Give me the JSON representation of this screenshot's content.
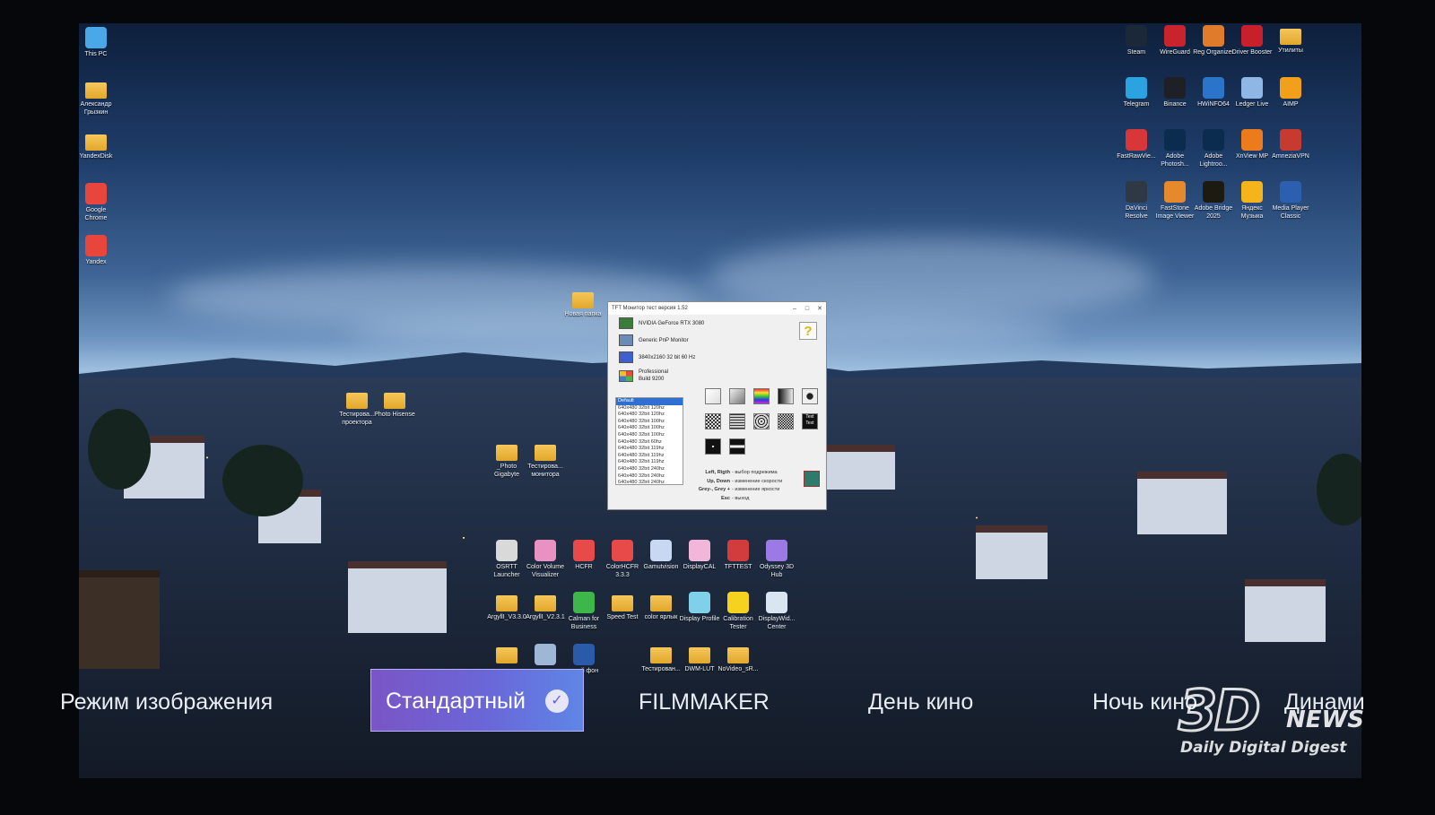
{
  "desktop_left_icons": [
    {
      "label": "This PC",
      "icon": "monitor-icon",
      "color": "#4aa8e8"
    },
    {
      "label": "Александр Грызкин",
      "icon": "user-folder-icon",
      "color": "#f1b540"
    },
    {
      "label": "YandexDisk",
      "icon": "folder-icon",
      "color": "#f1b540"
    },
    {
      "label": "Google Chrome",
      "icon": "chrome-icon",
      "color": "#e8453c"
    },
    {
      "label": "Yandex",
      "icon": "yandex-browser-icon",
      "color": "#e8453c"
    }
  ],
  "desktop_right_icons": [
    {
      "label": "Steam",
      "icon": "steam-icon",
      "color": "#1b2838"
    },
    {
      "label": "WireGuard",
      "icon": "wireguard-icon",
      "color": "#c9232d"
    },
    {
      "label": "Reg Organizer",
      "icon": "reg-organizer-icon",
      "color": "#e07b2c"
    },
    {
      "label": "Driver Booster",
      "icon": "driver-booster-icon",
      "color": "#c8202a"
    },
    {
      "label": "Утилиты",
      "icon": "folder-icon",
      "color": "#f1b540"
    },
    {
      "label": "Telegram",
      "icon": "telegram-icon",
      "color": "#2aa3e0"
    },
    {
      "label": "Binance",
      "icon": "binance-icon",
      "color": "#1e2026"
    },
    {
      "label": "HWiNFO64",
      "icon": "hwinfo-icon",
      "color": "#2a74c9"
    },
    {
      "label": "Ledger Live",
      "icon": "ledger-icon",
      "color": "#8fb7e6"
    },
    {
      "label": "AIMP",
      "icon": "aimp-icon",
      "color": "#f2a01c"
    },
    {
      "label": "FastRawVie...",
      "icon": "fastrawviewer-icon",
      "color": "#d8373a"
    },
    {
      "label": "Adobe Photosh...",
      "icon": "photoshop-icon",
      "color": "#0b2b4f"
    },
    {
      "label": "Adobe Lightroo...",
      "icon": "lightroom-icon",
      "color": "#0b2b4f"
    },
    {
      "label": "XnView MP",
      "icon": "xnview-icon",
      "color": "#ec7b1c"
    },
    {
      "label": "AmneziaVPN",
      "icon": "amneziavpn-icon",
      "color": "#c73a2f"
    },
    {
      "label": "DaVinci Resolve",
      "icon": "davinci-icon",
      "color": "#2f3946"
    },
    {
      "label": "FastStone Image Viewer",
      "icon": "faststone-icon",
      "color": "#e6892c"
    },
    {
      "label": "Adobe Bridge 2025",
      "icon": "bridge-icon",
      "color": "#1d1a12"
    },
    {
      "label": "Яндекс Музыка",
      "icon": "yandex-music-icon",
      "color": "#f4b41a"
    },
    {
      "label": "Media Player Classic",
      "icon": "mpc-icon",
      "color": "#2d5fb0"
    }
  ],
  "desktop_mid_icons": [
    {
      "label": "Тестирова... проектора",
      "icon": "folder-icon",
      "color": "#f1b540"
    },
    {
      "label": "Photo Hisense",
      "icon": "folder-icon",
      "color": "#f1b540"
    },
    {
      "label": "_Photo Gigabyte",
      "icon": "folder-icon",
      "color": "#f1b540"
    },
    {
      "label": "Тестирова... монитора",
      "icon": "folder-icon",
      "color": "#f1b540"
    },
    {
      "label": "Новая папка",
      "icon": "folder-icon",
      "color": "#f1b540"
    }
  ],
  "desktop_app_row1": [
    {
      "label": "OSRTT Launcher",
      "icon": "osrtt-icon",
      "color": "#d9d9d9"
    },
    {
      "label": "Color Volume Visualizer",
      "icon": "color-volume-icon",
      "color": "#e891c2"
    },
    {
      "label": "HCFR",
      "icon": "hcfr-icon",
      "color": "#e84a4a"
    },
    {
      "label": "ColorHCFR 3.3.3",
      "icon": "colorhcfr-icon",
      "color": "#e84a4a"
    },
    {
      "label": "Gamutvision",
      "icon": "gamutvision-icon",
      "color": "#c9d8f2"
    },
    {
      "label": "DisplayCAL",
      "icon": "displaycal-icon",
      "color": "#f2b7d8"
    },
    {
      "label": "TFTTEST",
      "icon": "tfttest-icon",
      "color": "#d33c3c"
    },
    {
      "label": "Odyssey 3D Hub",
      "icon": "odyssey-icon",
      "color": "#9b7ae6"
    }
  ],
  "desktop_app_row2": [
    {
      "label": "ArgyllI_V3.3.0",
      "icon": "folder-icon",
      "color": "#f1b540"
    },
    {
      "label": "ArgyllI_V2.3.1",
      "icon": "folder-icon",
      "color": "#f1b540"
    },
    {
      "label": "Calman for Business",
      "icon": "calman-icon",
      "color": "#3db64a"
    },
    {
      "label": "Speed Test",
      "icon": "folder-icon",
      "color": "#f1b540"
    },
    {
      "label": "color ярлык",
      "icon": "folder-icon",
      "color": "#f1b540"
    },
    {
      "label": "Display Profile",
      "icon": "display-profile-icon",
      "color": "#7fd0e8"
    },
    {
      "label": "Calibration Tester",
      "icon": "calibration-tester-icon",
      "color": "#f4d21f"
    },
    {
      "label": "DisplayWid... Center",
      "icon": "displaywidget-icon",
      "color": "#d9e6f2"
    }
  ],
  "desktop_app_row3": [
    {
      "label": "",
      "icon": "folder-icon",
      "color": "#f1b540"
    },
    {
      "label": "",
      "icon": "image-icon",
      "color": "#9fb7d6"
    },
    {
      "label": "..ный фон",
      "icon": "word-doc-icon",
      "color": "#2b5aa8"
    },
    {
      "label": "Тестирован...",
      "icon": "folder-icon",
      "color": "#f1b540"
    },
    {
      "label": "DWM-LUT",
      "icon": "folder-icon",
      "color": "#f1b540"
    },
    {
      "label": "NoVideo_sR...",
      "icon": "folder-icon",
      "color": "#f1b540"
    }
  ],
  "tft_window": {
    "title": "TFT Монитор тест версия 1.52",
    "gpu": "NVIDIA GeForce RTX 3080",
    "monitor": "Generic PnP Monitor",
    "resolution": "3840x2160 32 bit 60 Hz",
    "os_line1": "Professional",
    "os_line2": "Build 9200",
    "help": "?",
    "modes": [
      "Default",
      "640x480  32bit 120hz",
      "640x480  32bit 120hz",
      "640x480  32bit 100hz",
      "640x480  32bit 100hz",
      "640x480  32bit 100hz",
      "640x480  32bit 60hz",
      "640x480  32bit 119hz",
      "640x480  32bit 119hz",
      "640x480  32bit 119hz",
      "640x480  32bit 240hz",
      "640x480  32bit 240hz",
      "640x480  32bit 240hz"
    ],
    "test_text_label": "Text Text",
    "keys": [
      {
        "k": "Left, Rigth",
        "d": "- выбор подрежима"
      },
      {
        "k": "Up, Down",
        "d": "- изменение скорости"
      },
      {
        "k": "Grey-, Grey +",
        "d": "- изменение яркости"
      },
      {
        "k": "Esc",
        "d": "- выход"
      }
    ]
  },
  "osd": {
    "title": "Режим изображения",
    "options": [
      "Стандартный",
      "FILMMAKER",
      "День кино",
      "Ночь кино",
      "Динами"
    ],
    "selected": "Стандартный",
    "accent_from": "#7a55c6",
    "accent_to": "#5f86e6"
  },
  "watermark": {
    "brand": "3D",
    "news": "NEWS",
    "tagline": "Daily Digital Digest"
  }
}
